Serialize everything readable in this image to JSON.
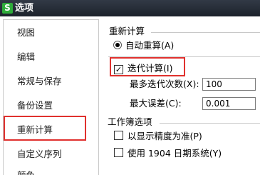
{
  "window": {
    "title": "选项",
    "icon_letter": "S"
  },
  "sidebar": {
    "items": [
      {
        "label": "视图"
      },
      {
        "label": "编辑"
      },
      {
        "label": "常规与保存"
      },
      {
        "label": "备份设置"
      },
      {
        "label": "重新计算",
        "selected": true
      },
      {
        "label": "自定义序列"
      },
      {
        "label": "颜色"
      }
    ]
  },
  "recalc": {
    "section_title": "重新计算",
    "auto_label": "自动重算(A)",
    "iterate_label": "迭代计算(I)",
    "iterate_checked": true,
    "iterate_checkmark": "✓",
    "max_iterations_label": "最多迭代次数(X):",
    "max_iterations_value": "100",
    "max_change_label": "最大误差(C):",
    "max_change_value": "0.001"
  },
  "workbook": {
    "section_title": "工作簿选项",
    "precision_label": "以显示精度为准(P)",
    "date1904_label": "使用 1904 日期系统(Y)"
  },
  "colors": {
    "highlight": "#e0312e",
    "title_bar": "#262c36",
    "app_icon": "#2eac3a"
  }
}
